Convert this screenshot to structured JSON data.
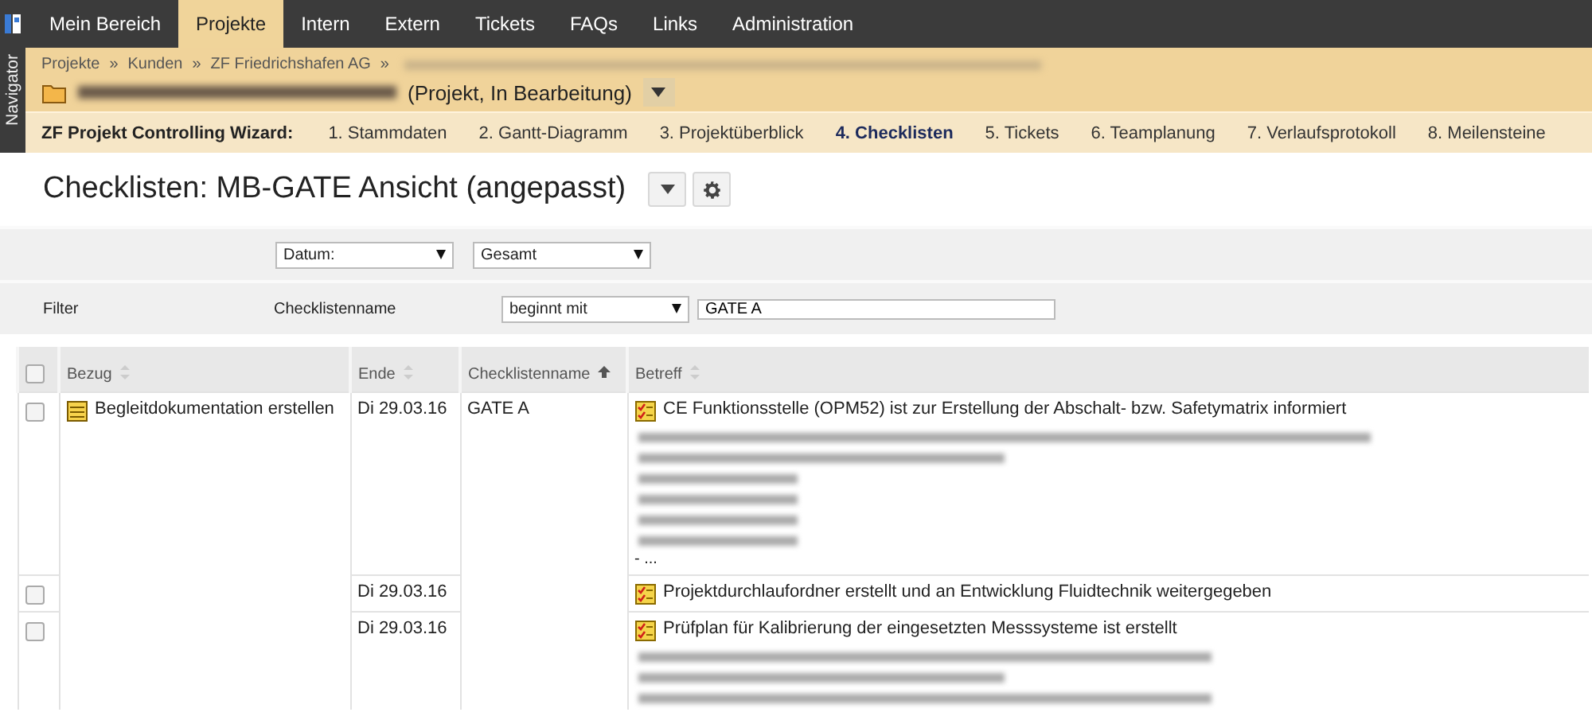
{
  "navigator": {
    "label": "Navigator"
  },
  "menu": [
    {
      "label": "Mein Bereich",
      "selected": false
    },
    {
      "label": "Projekte",
      "selected": true
    },
    {
      "label": "Intern",
      "selected": false
    },
    {
      "label": "Extern",
      "selected": false
    },
    {
      "label": "Tickets",
      "selected": false
    },
    {
      "label": "FAQs",
      "selected": false
    },
    {
      "label": "Links",
      "selected": false
    },
    {
      "label": "Administration",
      "selected": false
    }
  ],
  "breadcrumb": {
    "separator": "»",
    "items": [
      "Projekte",
      "Kunden",
      "ZF Friedrichshafen AG"
    ]
  },
  "project": {
    "status": "(Projekt, In Bearbeitung)"
  },
  "wizard": {
    "title": "ZF Projekt Controlling Wizard:",
    "steps": [
      {
        "label": "1. Stammdaten",
        "selected": false
      },
      {
        "label": "2. Gantt-Diagramm",
        "selected": false
      },
      {
        "label": "3. Projektüberblick",
        "selected": false
      },
      {
        "label": "4. Checklisten",
        "selected": true
      },
      {
        "label": "5. Tickets",
        "selected": false
      },
      {
        "label": "6. Teamplanung",
        "selected": false
      },
      {
        "label": "7. Verlaufsprotokoll",
        "selected": false
      },
      {
        "label": "8. Meilensteine",
        "selected": false
      }
    ]
  },
  "page_title": "Checklisten: MB-GATE Ansicht (angepasst)",
  "filters": {
    "date_field": "Datum:",
    "range": "Gesamt",
    "label": "Filter",
    "field_label": "Checklistenname",
    "operator": "beginnt mit",
    "value": "GATE A"
  },
  "table": {
    "all_checked": false,
    "columns": [
      {
        "label": "Bezug",
        "sorted": false
      },
      {
        "label": "Ende",
        "sorted": false
      },
      {
        "label": "Checklistenname",
        "sorted": true
      },
      {
        "label": "Betreff",
        "sorted": false
      }
    ],
    "rows": [
      {
        "checked": false,
        "bezug": "Begleitdokumentation erstellen",
        "ende": "Di 29.03.16",
        "checklist": "GATE A",
        "betreff": "CE Funktionsstelle (OPM52) ist zur Erstellung der Abschalt- bzw. Safetymatrix informiert",
        "redacted_notes": true,
        "more": "- ..."
      },
      {
        "checked": false,
        "bezug": "",
        "ende": "Di 29.03.16",
        "checklist": "",
        "betreff": "Projektdurchlaufordner erstellt und an Entwicklung Fluidtechnik weitergegeben",
        "redacted_notes": false
      },
      {
        "checked": false,
        "bezug": "",
        "ende": "Di 29.03.16",
        "checklist": "",
        "betreff": "Prüfplan für Kalibrierung der eingesetzten Messsysteme ist erstellt",
        "redacted_notes": true
      }
    ]
  }
}
